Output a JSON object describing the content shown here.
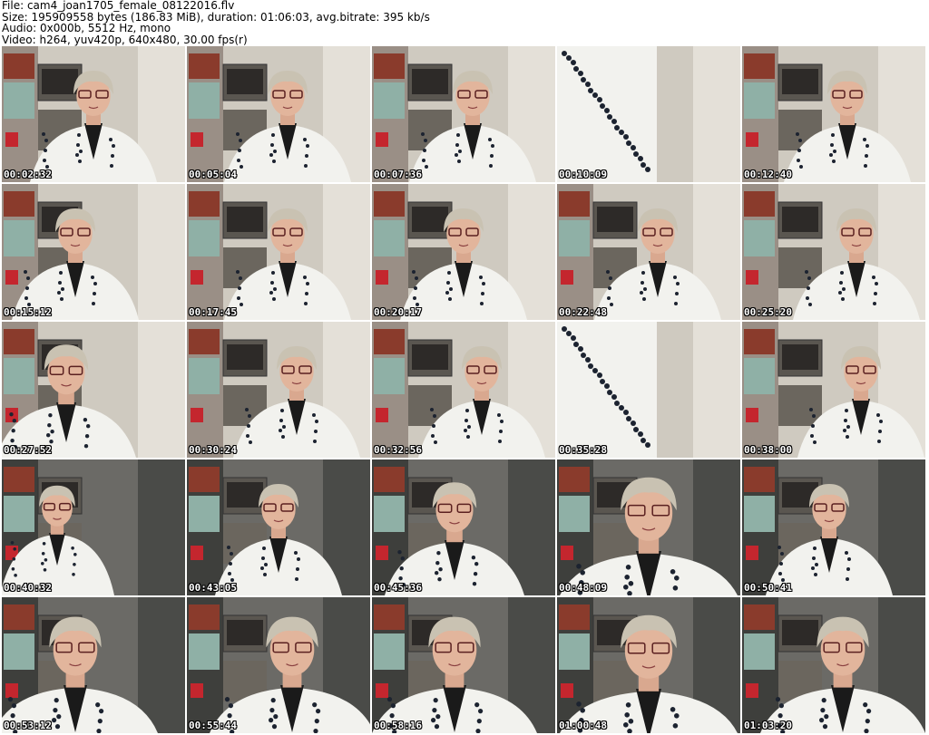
{
  "header": {
    "file": "File: cam4_joan1705_female_08122016.flv",
    "size": "Size: 195909558 bytes (186.83 MiB), duration: 01:06:03, avg.bitrate: 395 kb/s",
    "audio": "Audio: 0x000b, 5512 Hz, mono",
    "video": "Video: h264, yuv420p, 640x480, 30.00 fps(r)"
  },
  "thumbnails": [
    {
      "time": "00:02:32"
    },
    {
      "time": "00:05:04"
    },
    {
      "time": "00:07:36"
    },
    {
      "time": "00:10:09"
    },
    {
      "time": "00:12:40"
    },
    {
      "time": "00:15:12"
    },
    {
      "time": "00:17:45"
    },
    {
      "time": "00:20:17"
    },
    {
      "time": "00:22:48"
    },
    {
      "time": "00:25:20"
    },
    {
      "time": "00:27:52"
    },
    {
      "time": "00:30:24"
    },
    {
      "time": "00:32:56"
    },
    {
      "time": "00:35:28"
    },
    {
      "time": "00:38:00"
    },
    {
      "time": "00:40:32"
    },
    {
      "time": "00:43:05"
    },
    {
      "time": "00:45:36"
    },
    {
      "time": "00:48:09"
    },
    {
      "time": "00:50:41"
    },
    {
      "time": "00:53:12"
    },
    {
      "time": "00:55:44"
    },
    {
      "time": "00:58:16"
    },
    {
      "time": "01:00:48"
    },
    {
      "time": "01:03:20"
    }
  ]
}
